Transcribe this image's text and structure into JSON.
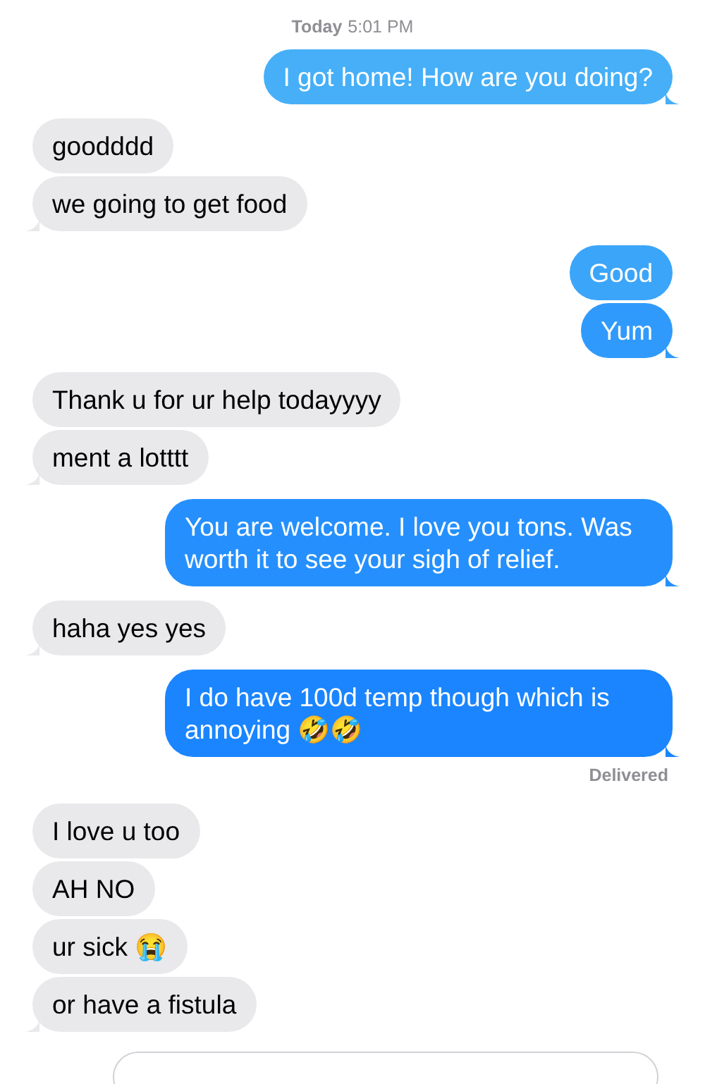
{
  "timestamp": {
    "day": "Today",
    "time": "5:01 PM"
  },
  "messages": [
    {
      "kind": "sent",
      "text": "I got home! How are you doing?",
      "tail": true
    },
    {
      "kind": "received",
      "text": "goodddd",
      "tail": false
    },
    {
      "kind": "received",
      "text": "we going to get food",
      "tail": true
    },
    {
      "kind": "sent",
      "text": "Good",
      "tail": false
    },
    {
      "kind": "sent",
      "text": "Yum",
      "tail": true
    },
    {
      "kind": "received",
      "text": "Thank u for ur help todayyyy",
      "tail": false
    },
    {
      "kind": "received",
      "text": "ment a lotttt",
      "tail": true
    },
    {
      "kind": "sent",
      "text": "You are welcome. I love you tons. Was worth it to see your sigh of relief.",
      "tail": true
    },
    {
      "kind": "received",
      "text": "haha yes yes",
      "tail": true
    },
    {
      "kind": "sent",
      "text": "I do have 100d temp though which is annoying 🤣🤣",
      "tail": true,
      "status": "Delivered"
    },
    {
      "kind": "received",
      "text": "I love u too",
      "tail": false
    },
    {
      "kind": "received",
      "text": "AH NO",
      "tail": false
    },
    {
      "kind": "received",
      "text": "ur sick 😭",
      "tail": false
    },
    {
      "kind": "received",
      "text": "or have a fistula",
      "tail": true
    }
  ],
  "composer": {
    "kind": "field"
  }
}
